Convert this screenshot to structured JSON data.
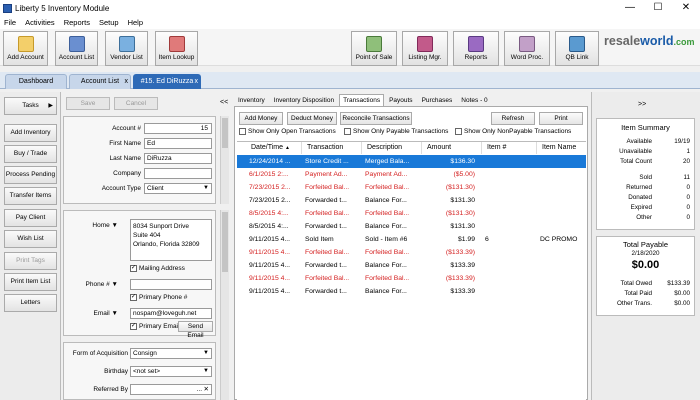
{
  "window": {
    "title": "Liberty 5 Inventory Module",
    "minimize": "—",
    "maximize": "☐",
    "close": "✕"
  },
  "menu": [
    "File",
    "Activities",
    "Reports",
    "Setup",
    "Help"
  ],
  "toolbar": {
    "left": [
      "Add Account",
      "Account List",
      "Vendor List",
      "Item Lookup"
    ],
    "right": [
      "Point of Sale",
      "Listing Mgr.",
      "Reports",
      "Word Proc.",
      "QB Link"
    ],
    "logo_a": "resale",
    "logo_b": "world",
    "logo_c": ".com",
    "colors": {
      "logo_gray": "#666666",
      "logo_blue": "#1a5ba8",
      "logo_green": "#3a9a3a"
    }
  },
  "doc_tabs": {
    "dashboard": "Dashboard",
    "account_list": "Account List",
    "active": "#15. Ed DiRuzza",
    "close": "x",
    "close2": "x"
  },
  "left_buttons": {
    "tasks": "Tasks",
    "add_inventory": "Add Inventory",
    "buy_trade": "Buy / Trade",
    "process_pending": "Process Pending",
    "transfer_items": "Transfer Items",
    "pay_client": "Pay Client",
    "wish_list": "Wish List",
    "print_tags": "Print Tags",
    "print_item_list": "Print Item List",
    "letters": "Letters"
  },
  "form": {
    "save": "Save",
    "cancel": "Cancel",
    "collapse": "<<",
    "account_label": "Account #",
    "account_value": "15",
    "first_label": "First Name",
    "first_value": "Ed",
    "last_label": "Last Name",
    "last_value": "DiRuzza",
    "company_label": "Company",
    "company_value": "",
    "type_label": "Account Type",
    "type_value": "Client",
    "home_label": "Home",
    "address_1": "8034 Sunport Drive",
    "address_2": "Suite 404",
    "address_3": "Orlando, Florida  32809",
    "mailing": "Mailing Address",
    "phone_label": "Phone #",
    "phone_value": "",
    "primary_phone": "Primary Phone #",
    "email_label": "Email",
    "email_value": "nospam@loveguh.net",
    "primary_email": "Primary Email",
    "send_email": "Send Email",
    "acq_label": "Form of Acquisition",
    "acq_value": "Consign",
    "birthday_label": "Birthday",
    "birthday_value": "<not set>",
    "referred_label": "Referred By",
    "referred_value": "",
    "dots": "...",
    "clear": "✕"
  },
  "right_tabs": [
    "Inventory",
    "Inventory Disposition",
    "Transactions",
    "Payouts",
    "Purchases",
    "Notes - 0"
  ],
  "actions": {
    "add_money": "Add Money",
    "deduct_money": "Deduct Money",
    "reconcile": "Reconcile Transactions",
    "refresh": "Refresh",
    "print": "Print"
  },
  "filters": [
    "Show Only Open Transactions",
    "Show Only Payable Transactions",
    "Show Only NonPayable Transactions"
  ],
  "table": {
    "headers": [
      "Date/Time",
      "Transaction",
      "Description",
      "Amount",
      "Item #",
      "Item Name"
    ],
    "sort_mark": "▲",
    "rows": [
      [
        "12/24/2014 ...",
        "Store Credit ...",
        "Merged Bala...",
        "$136.30",
        "",
        ""
      ],
      [
        "6/1/2015 2:...",
        "Payment Ad...",
        "Payment Ad...",
        "($5.00)",
        "",
        ""
      ],
      [
        "7/23/2015 2...",
        "Forfeited Bal...",
        "Forfeited Bal...",
        "($131.30)",
        "",
        ""
      ],
      [
        "7/23/2015 2...",
        "Forwarded t...",
        "Balance For...",
        "$131.30",
        "",
        ""
      ],
      [
        "8/5/2015 4:...",
        "Forfeited Bal...",
        "Forfeited Bal...",
        "($131.30)",
        "",
        ""
      ],
      [
        "8/5/2015 4:...",
        "Forwarded t...",
        "Balance For...",
        "$131.30",
        "",
        ""
      ],
      [
        "9/11/2015 4...",
        "Sold Item",
        "Sold - Item #6",
        "$1.99",
        "6",
        "DC PROMO"
      ],
      [
        "9/11/2015 4...",
        "Forfeited Bal...",
        "Forfeited Bal...",
        "($133.39)",
        "",
        ""
      ],
      [
        "9/11/2015 4...",
        "Forwarded t...",
        "Balance For...",
        "$133.39",
        "",
        ""
      ],
      [
        "9/11/2015 4...",
        "Forfeited Bal...",
        "Forfeited Bal...",
        "($133.39)",
        "",
        ""
      ],
      [
        "9/11/2015 4...",
        "Forwarded t...",
        "Balance For...",
        "$133.39",
        "",
        ""
      ]
    ],
    "row_states": [
      "selected",
      "red",
      "red",
      "normal",
      "red",
      "normal",
      "normal",
      "red",
      "normal",
      "red",
      "normal"
    ],
    "colors": {
      "selected_bg": "#1979d8",
      "negative": "#d42020"
    }
  },
  "summary": {
    "expand": ">>",
    "item_title": "Item Summary",
    "item_rows": [
      [
        "Available",
        "19/19"
      ],
      [
        "Unavailable",
        "1"
      ],
      [
        "Total Count",
        "20"
      ],
      [
        "Sold",
        "11"
      ],
      [
        "Returned",
        "0"
      ],
      [
        "Donated",
        "0"
      ],
      [
        "Expired",
        "0"
      ],
      [
        "Other",
        "0"
      ]
    ],
    "payable_title": "Total Payable",
    "payable_date": "2/18/2020",
    "payable_amount": "$0.00",
    "payable_rows": [
      [
        "Total Owed",
        "$133.39"
      ],
      [
        "Total Paid",
        "$0.00"
      ],
      [
        "Other Trans.",
        "$0.00"
      ]
    ]
  }
}
